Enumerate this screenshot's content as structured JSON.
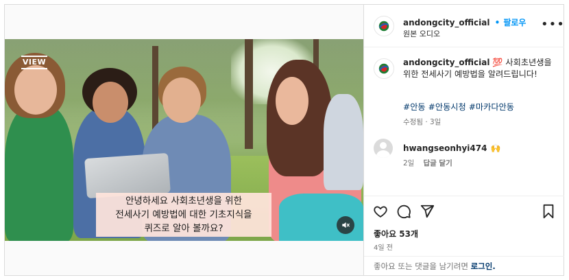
{
  "post": {
    "account": "andongcity_official",
    "follow_label": "팔로우",
    "audio_label": "원본 오디오",
    "more_label": "•••",
    "caption_user": "andongcity_official",
    "caption_emoji": "💯",
    "caption_text": "사회초년생을 위한 전세사기 예방법을 알려드립니다!",
    "hashtags": [
      "#안동",
      "#안동시청",
      "#마카다안동"
    ],
    "edited_label": "수정됨 · 3일",
    "comment": {
      "user": "hwangseonhyi474",
      "emoji": "🙌",
      "time": "2일",
      "reply_label": "답글 달기"
    },
    "likes_label": "좋아요 53개",
    "posted_ago": "4일 전",
    "login_prompt": "좋아요 또는 댓글을 남기려면",
    "login_link": "로그인."
  },
  "video": {
    "logo_text": "VIEW",
    "subtitle": "안녕하세요 사회초년생을 위한\n전세사기 예방법에 대한 기초지식을\n퀴즈로 알아 볼까요?",
    "muted": true
  },
  "icons": {
    "avatar": "andong-city-logo-icon",
    "like": "heart-icon",
    "comment": "comment-bubble-icon",
    "share": "paper-plane-icon",
    "save": "bookmark-icon",
    "mute": "speaker-muted-icon",
    "more": "more-horizontal-icon",
    "comment_avatar": "default-avatar-icon"
  },
  "colors": {
    "link_blue": "#0095f6",
    "hashtag_blue": "#00376b",
    "text": "#262626",
    "secondary_text": "#737373",
    "border": "#dbdbdb"
  }
}
